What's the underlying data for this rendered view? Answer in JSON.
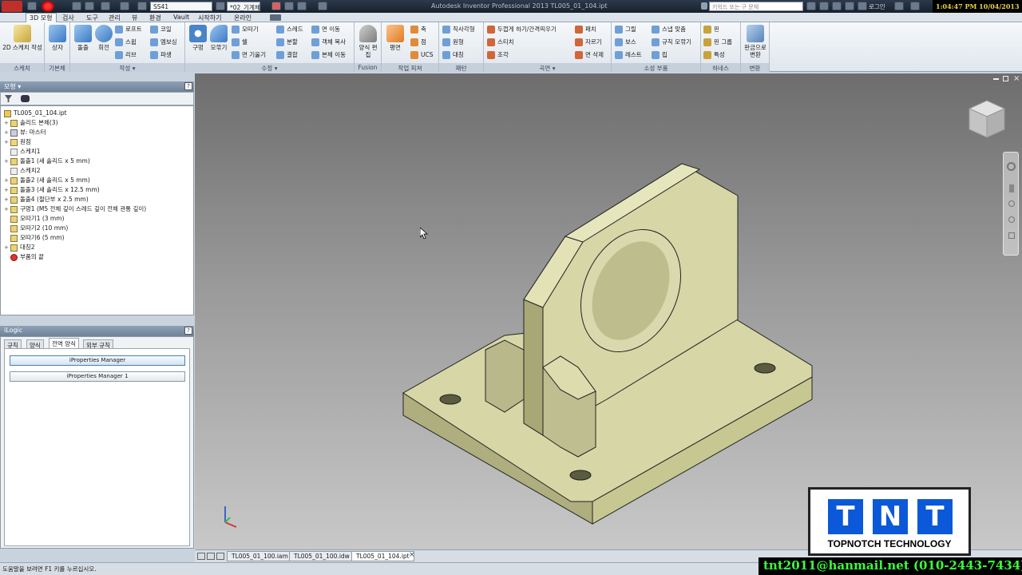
{
  "titlebar": {
    "title": "Autodesk Inventor Professional 2013    TL005_01_104.ipt",
    "project": "SS41",
    "project2": "*02_기계체",
    "search_placeholder": "키워드 또는 구 문체",
    "login": "로그인",
    "clock": "1:04:47 PM 10/04/2013"
  },
  "menu_tabs": [
    "3D 모형",
    "검사",
    "도구",
    "관리",
    "뷰",
    "환경",
    "Vault",
    "시작하기",
    "온라인"
  ],
  "ribbon": {
    "panels": [
      {
        "label": "스케치",
        "big": [
          "2D 스케치 작성"
        ],
        "small": []
      },
      {
        "label": "기본체",
        "big": [
          "상자"
        ],
        "small": []
      },
      {
        "label": "작성 ▾",
        "big": [
          "돌출",
          "회전"
        ],
        "small": [
          "로프트",
          "스윕",
          "리브",
          "코일",
          "엠보싱",
          "파생"
        ]
      },
      {
        "label": "수정 ▾",
        "big": [
          "구멍",
          "모깎기"
        ],
        "small": [
          "모따기",
          "쉘",
          "면 기울기",
          "스레드",
          "분할",
          "결합",
          "면 이동",
          "객체 복사",
          "본체 이동"
        ]
      },
      {
        "label": "Fusion",
        "big": [
          "양식 편집"
        ],
        "small": []
      },
      {
        "label": "작업 피쳐",
        "big": [
          "평면"
        ],
        "small": [
          "축",
          "점",
          "UCS"
        ]
      },
      {
        "label": "패턴",
        "big": [],
        "small": [
          "직사각형",
          "원형",
          "대칭"
        ]
      },
      {
        "label": "곡면 ▾",
        "big": [],
        "small": [
          "두껍게 하기/간격띄우기",
          "스티치",
          "조각",
          "패치",
          "자르기",
          "면 삭제"
        ]
      },
      {
        "label": "소성 부품",
        "big": [],
        "small": [
          "그릴",
          "보스",
          "레스트",
          "스냅 맞춤",
          "규칙 모깎기",
          "립"
        ]
      },
      {
        "label": "하네스",
        "big": [],
        "small": [
          "핀",
          "핀 그룹",
          "특성"
        ]
      },
      {
        "label": "변환",
        "big": [
          "판금으로 변환"
        ],
        "small": []
      }
    ]
  },
  "browser": {
    "title": "모형 ▾",
    "help": "?",
    "items": [
      {
        "label": "TL005_01_104.ipt",
        "level": 0,
        "expander": ""
      },
      {
        "label": "솔리드 본체(3)",
        "level": 1,
        "expander": "+"
      },
      {
        "label": "뷰: 마스터",
        "level": 1,
        "expander": "+"
      },
      {
        "label": "원점",
        "level": 1,
        "expander": "+"
      },
      {
        "label": "스케치1",
        "level": 1,
        "expander": ""
      },
      {
        "label": "돌출1 (새 솔리드 x 5 mm)",
        "level": 1,
        "expander": "+"
      },
      {
        "label": "스케치2",
        "level": 1,
        "expander": ""
      },
      {
        "label": "돌출2 (새 솔리드 x 5 mm)",
        "level": 1,
        "expander": "+"
      },
      {
        "label": "돌출3 (새 솔리드 x 12.5 mm)",
        "level": 1,
        "expander": "+"
      },
      {
        "label": "돌출4 (절단부 x 2.5 mm)",
        "level": 1,
        "expander": "+"
      },
      {
        "label": "구멍1 (M5 전체 깊이 스레드 깊이 전체 관통 깊이)",
        "level": 1,
        "expander": "+"
      },
      {
        "label": "모따기1 (3 mm)",
        "level": 1,
        "expander": ""
      },
      {
        "label": "모따기2 (10 mm)",
        "level": 1,
        "expander": ""
      },
      {
        "label": "모따기6 (5 mm)",
        "level": 1,
        "expander": ""
      },
      {
        "label": "대칭2",
        "level": 1,
        "expander": "+"
      },
      {
        "label": "부품의 끝",
        "level": 1,
        "expander": ""
      }
    ]
  },
  "ilogic": {
    "title": "iLogic",
    "help": "?",
    "tabs": [
      "규칙",
      "양식",
      "전역 양식",
      "외부 규칙"
    ],
    "active_tab": 2,
    "buttons": [
      "iProperties Manager",
      "iProperties Manager 1"
    ]
  },
  "doc_tabs": [
    "TL005_01_100.iam",
    "TL005_01_100.idw",
    "TL005_01_104.ipt"
  ],
  "status_text": "도움말을 보려면 F1 키를 누르십시오.",
  "watermark": {
    "company": "TOPNOTCH TECHNOLOGY",
    "letters": [
      "T",
      "N",
      "T"
    ],
    "contact": "tnt2011@hanmail.net (010-2443-7434)"
  },
  "colors": {
    "model_face": "#d6d6a7",
    "model_dark": "#aeae7e",
    "viewport_top": "#6d6d6d",
    "viewport_bottom": "#c8c8c8",
    "logo_blue": "#0b58d8"
  }
}
